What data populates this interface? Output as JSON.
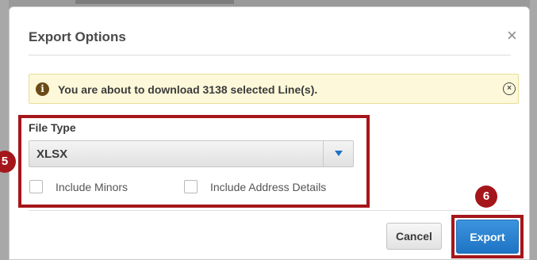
{
  "dialog": {
    "title": "Export Options",
    "close_glyph": "×"
  },
  "alert": {
    "icon": "info-icon",
    "icon_glyph": "i",
    "message": "You are about to download 3138 selected Line(s).",
    "dismiss_glyph": "×",
    "background_color": "#fcf8d9"
  },
  "file_type": {
    "label": "File Type",
    "selected": "XLSX"
  },
  "options": [
    {
      "label": "Include Minors",
      "checked": false
    },
    {
      "label": "Include Address Details",
      "checked": false
    }
  ],
  "buttons": {
    "cancel_label": "Cancel",
    "export_label": "Export"
  },
  "callouts": {
    "step_5": "5",
    "step_6": "6",
    "color": "#a5161b"
  },
  "colors": {
    "primary_button": "#1e74c4",
    "select_arrow": "#1e74c4"
  }
}
